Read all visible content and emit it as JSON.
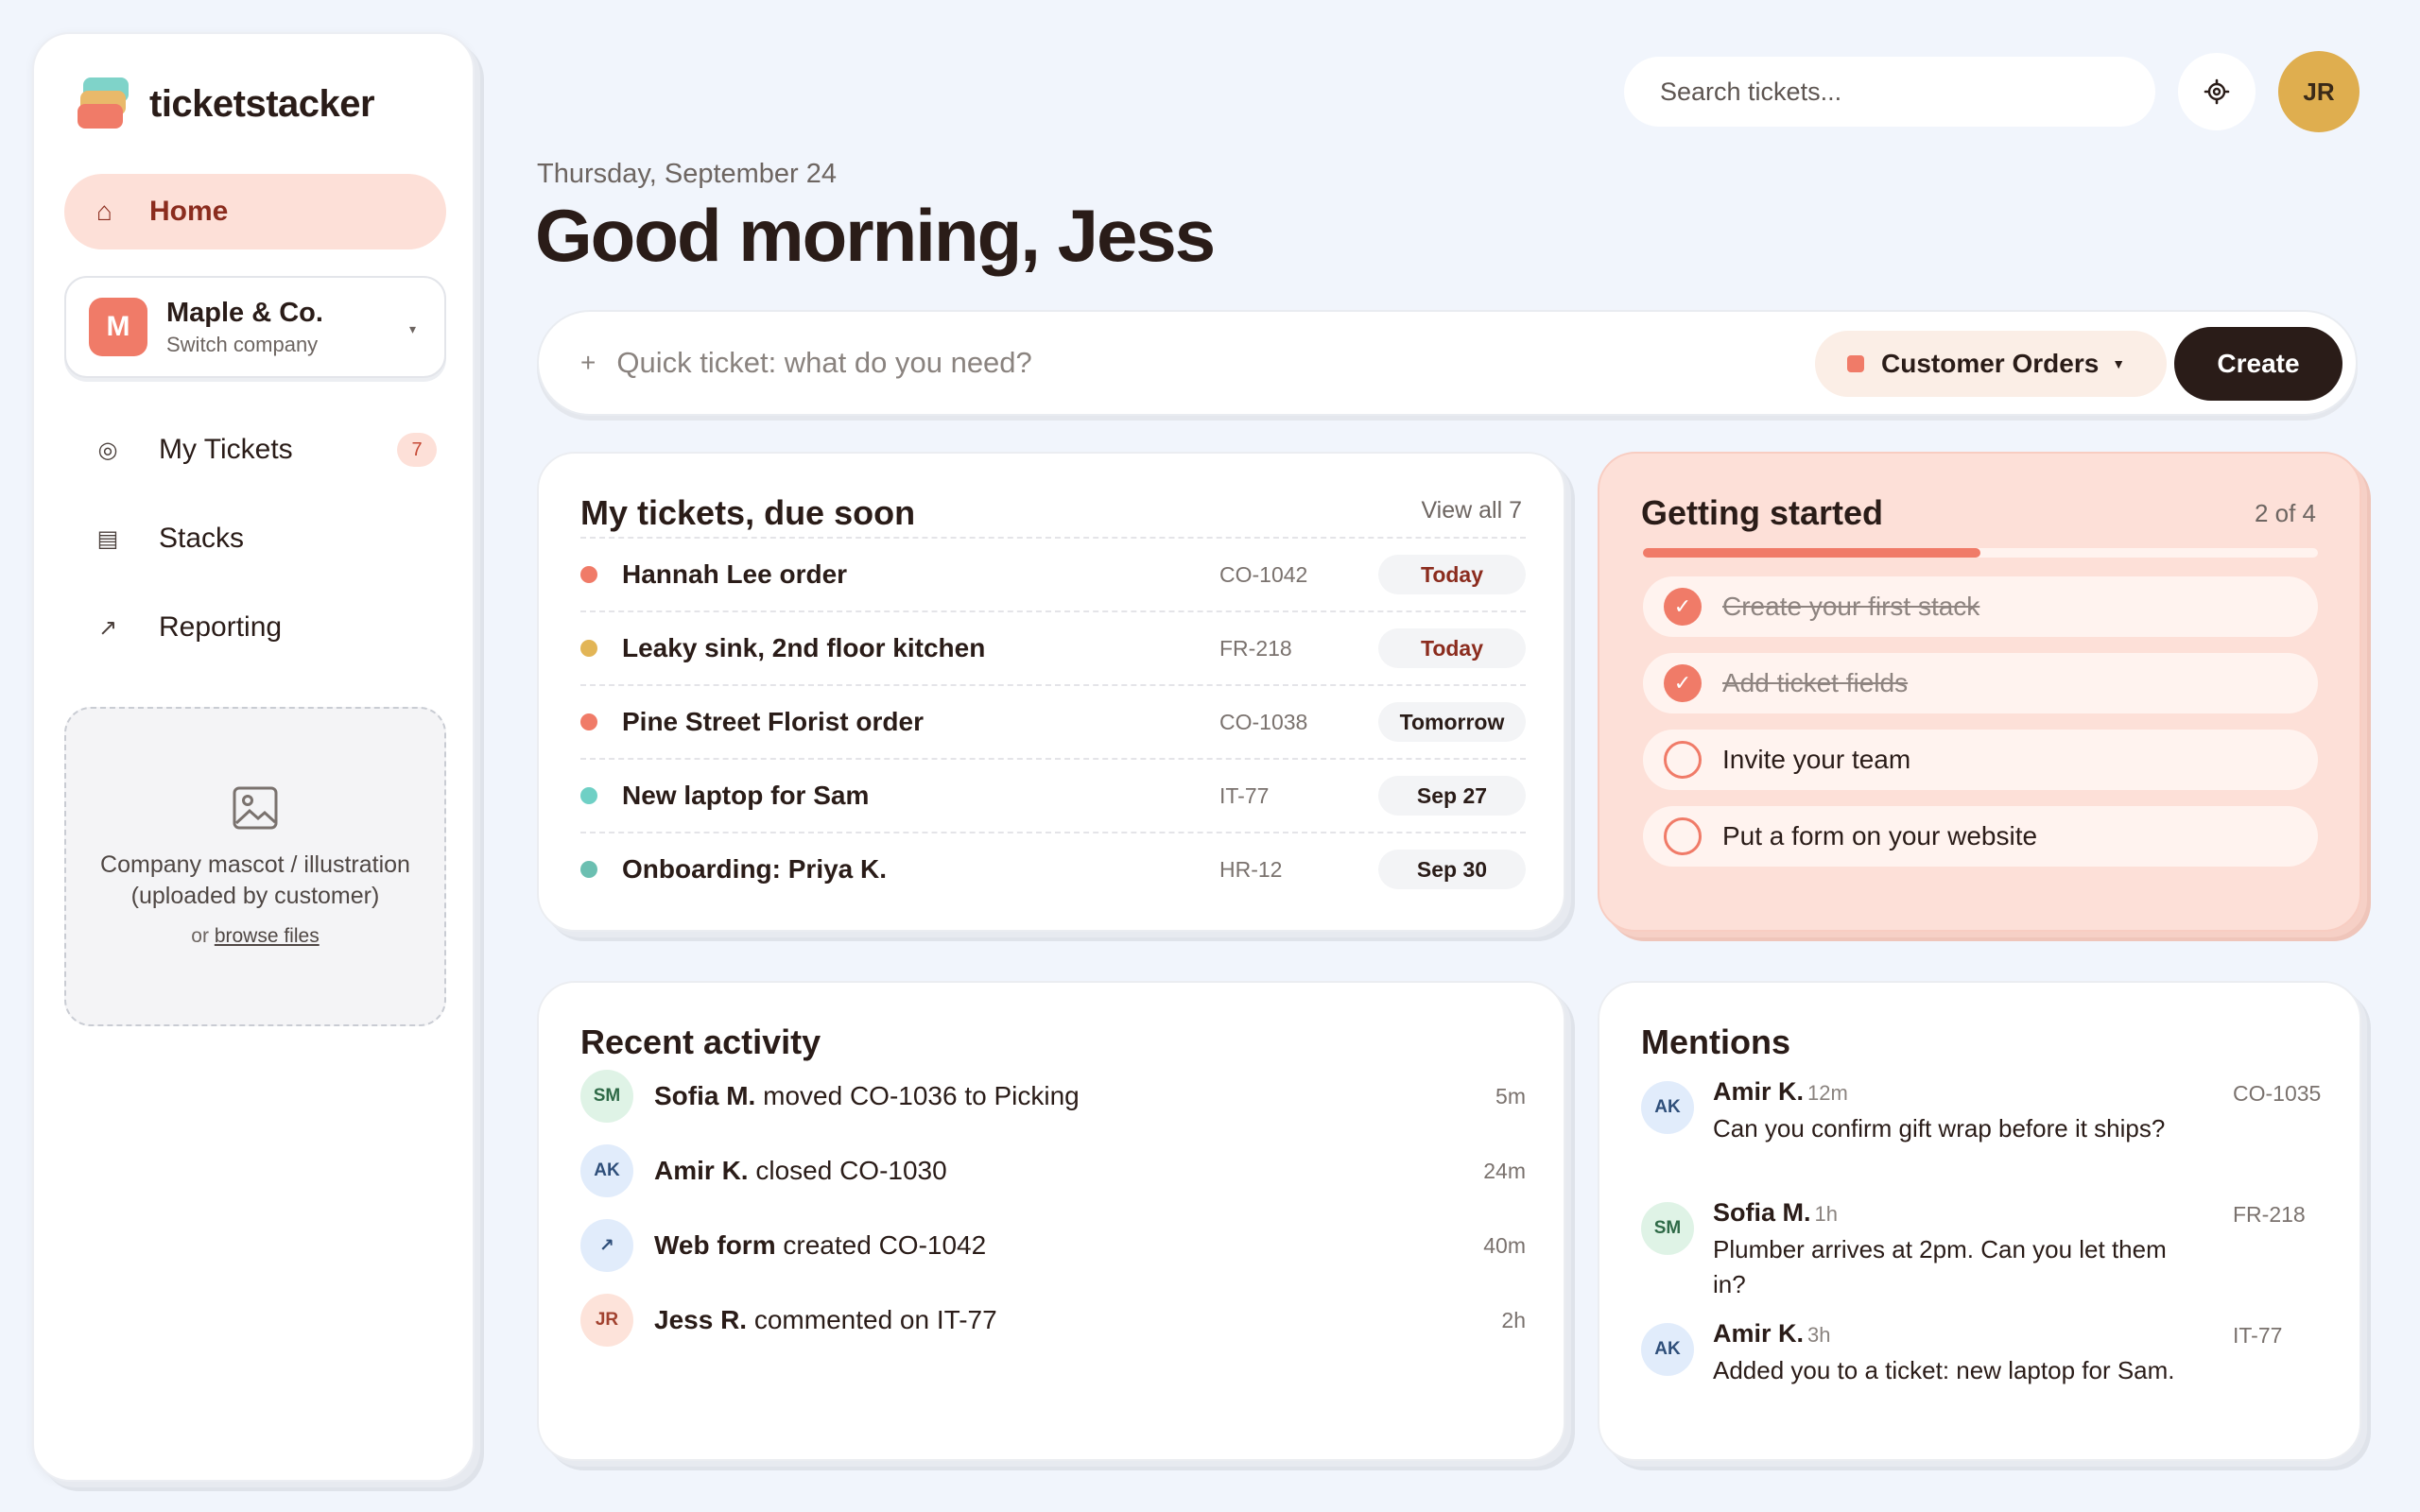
{
  "app": {
    "name": "ticketstacker"
  },
  "sidebar": {
    "home": {
      "icon": "home-icon",
      "label": "Home"
    },
    "company": {
      "initial": "M",
      "name": "Maple & Co.",
      "sub": "Switch company"
    },
    "items": [
      {
        "icon": "target-icon",
        "label": "My Tickets",
        "badge": "7"
      },
      {
        "icon": "stack-icon",
        "label": "Stacks"
      },
      {
        "icon": "trend-icon",
        "label": "Reporting"
      }
    ],
    "mascot": {
      "text": "Company mascot / illustration (uploaded by customer)",
      "or": "or",
      "browse": "browse files"
    }
  },
  "header": {
    "search_placeholder": "Search tickets...",
    "user_initials": "JR"
  },
  "greeting": {
    "date": "Thursday, September 24",
    "title": "Good morning, Jess"
  },
  "quick": {
    "placeholder": "Quick ticket: what do you need?",
    "category": "Customer Orders",
    "category_color": "#f07b68",
    "create": "Create"
  },
  "tickets": {
    "title": "My tickets, due soon",
    "view_all": "View all 7",
    "rows": [
      {
        "name": "Hannah Lee order",
        "id": "CO-1042",
        "due": "Today",
        "color": "#f07b68"
      },
      {
        "name": "Leaky sink, 2nd floor kitchen",
        "id": "FR-218",
        "due": "Today",
        "color": "#e2b556"
      },
      {
        "name": "Pine Street Florist order",
        "id": "CO-1038",
        "due": "Tomorrow",
        "color": "#f07b68"
      },
      {
        "name": "New laptop for Sam",
        "id": "IT-77",
        "due": "Sep 27",
        "color": "#6fd0c5"
      },
      {
        "name": "Onboarding: Priya K.",
        "id": "HR-12",
        "due": "Sep 30",
        "color": "#6bbfb1"
      }
    ]
  },
  "getting_started": {
    "title": "Getting started",
    "count": "2 of 4",
    "progress": 0.5,
    "steps": [
      {
        "label": "Create your first stack",
        "done": true
      },
      {
        "label": "Add ticket fields",
        "done": true
      },
      {
        "label": "Invite your team",
        "done": false
      },
      {
        "label": "Put a form on your website",
        "done": false
      }
    ]
  },
  "activity": {
    "title": "Recent activity",
    "rows": [
      {
        "initials": "SM",
        "actor": "Sofia M.",
        "text": "moved CO-1036 to Picking",
        "time": "5m"
      },
      {
        "initials": "AK",
        "actor": "Amir K.",
        "text": "closed CO-1030",
        "time": "24m"
      },
      {
        "initials": "↗",
        "actor": "Web form",
        "text": "created CO-1042",
        "time": "40m"
      },
      {
        "initials": "JR",
        "actor": "Jess R.",
        "text": "commented on IT-77",
        "time": "2h"
      }
    ]
  },
  "mentions": {
    "title": "Mentions",
    "rows": [
      {
        "initials": "AK",
        "name": "Amir K.",
        "time": "12m",
        "body": "Can you confirm gift wrap before it ships?",
        "id": "CO-1035"
      },
      {
        "initials": "SM",
        "name": "Sofia M.",
        "time": "1h",
        "body": "Plumber arrives at 2pm. Can you let them in?",
        "id": "FR-218"
      },
      {
        "initials": "AK",
        "name": "Amir K.",
        "time": "3h",
        "body": "Added you to a ticket: new laptop for Sam.",
        "id": "IT-77"
      }
    ]
  }
}
